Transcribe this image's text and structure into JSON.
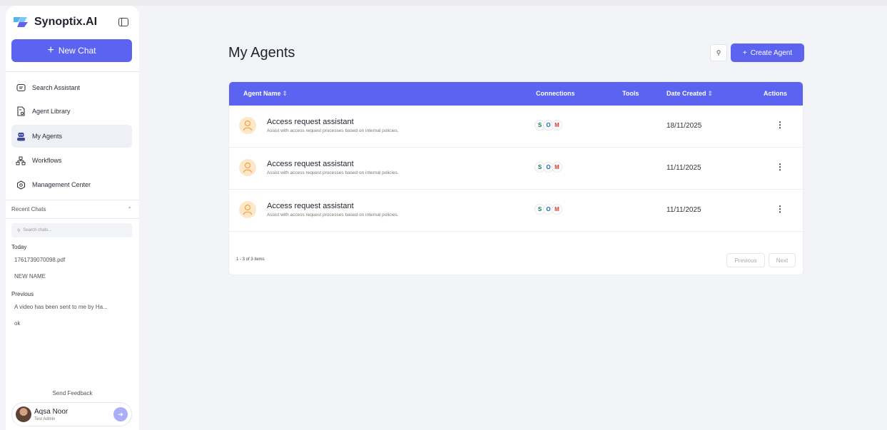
{
  "brand": {
    "name": "Synoptix.AI"
  },
  "sidebar": {
    "new_chat_label": "New Chat",
    "nav": [
      {
        "label": "Search Assistant",
        "icon": "chat-bubble-icon"
      },
      {
        "label": "Agent Library",
        "icon": "document-gear-icon"
      },
      {
        "label": "My Agents",
        "icon": "robot-icon"
      },
      {
        "label": "Workflows",
        "icon": "workflow-icon"
      },
      {
        "label": "Management Center",
        "icon": "settings-hex-icon"
      }
    ],
    "recent_chats_label": "Recent Chats",
    "search_placeholder": "Search chats...",
    "groups": [
      {
        "label": "Today",
        "items": [
          "1761739070098.pdf",
          "NEW NAME"
        ]
      },
      {
        "label": "Previous",
        "items": [
          "A video has been sent to me by Ha...",
          "ok"
        ]
      }
    ],
    "feedback_label": "Send Feedback",
    "user": {
      "name": "Aqsa Noor",
      "role": "Test Admin"
    }
  },
  "main": {
    "title": "My Agents",
    "create_label": "Create Agent",
    "columns": [
      "Agent Name",
      "Connections",
      "Tools",
      "Date Created",
      "Actions"
    ],
    "rows": [
      {
        "name": "Access request assistant",
        "description": "Assist with access request processes based on internal policies.",
        "date": "18/11/2025"
      },
      {
        "name": "Access request assistant",
        "description": "Assist with access request processes based on internal policies.",
        "date": "11/11/2025"
      },
      {
        "name": "Access request assistant",
        "description": "Assist with access request processes based on internal policies.",
        "date": "11/11/2025"
      }
    ],
    "pagination": {
      "summary": "1 - 3 of 3 items",
      "previous": "Previous",
      "next": "Next"
    }
  },
  "colors": {
    "accent": "#5b63f0",
    "agent_icon_bg": "#fde7c8"
  }
}
